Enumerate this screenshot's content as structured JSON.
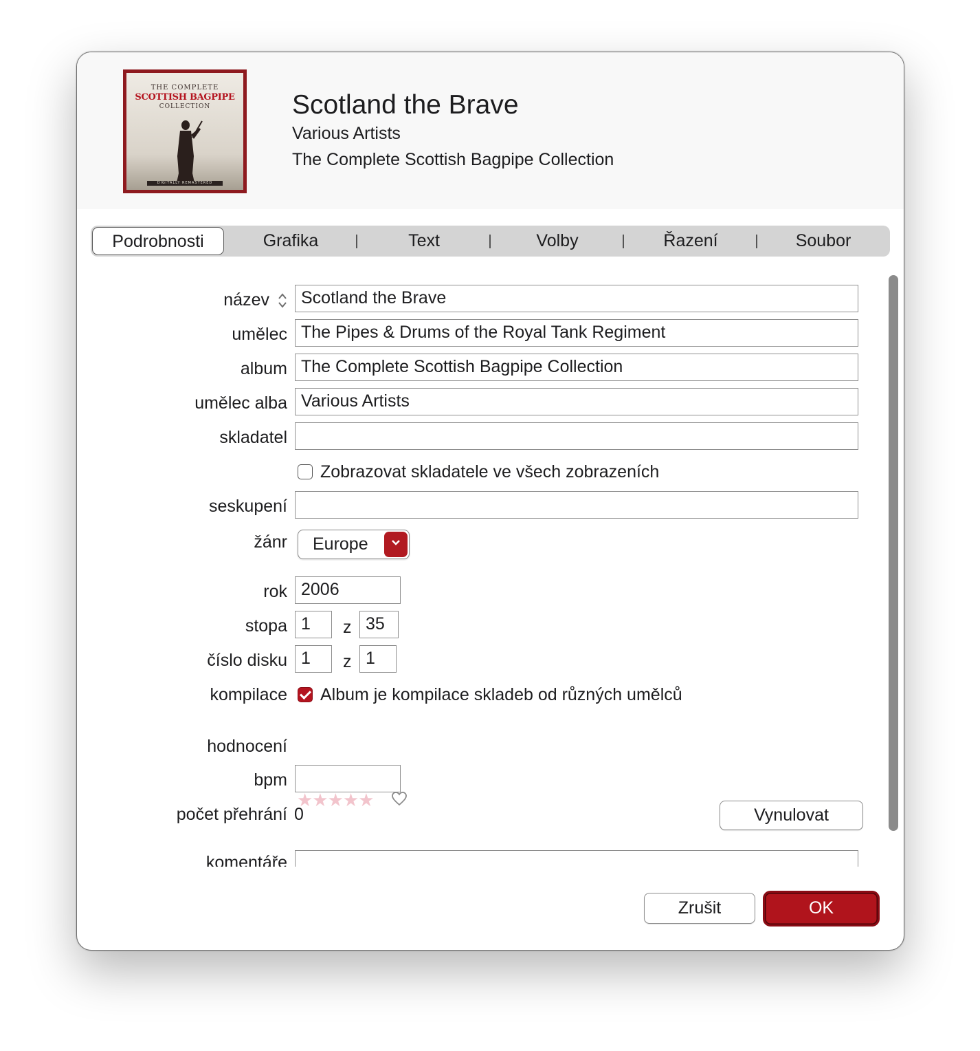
{
  "header": {
    "artwork": {
      "line1": "THE COMPLETE",
      "line2": "SCOTTISH BAGPIPE",
      "line3": "COLLECTION",
      "footer": "DIGITALLY REMASTERED"
    },
    "title": "Scotland the Brave",
    "artist": "Various Artists",
    "album": "The Complete Scottish Bagpipe Collection"
  },
  "tabs": [
    "Podrobnosti",
    "Grafika",
    "Text",
    "Volby",
    "Řazení",
    "Soubor"
  ],
  "active_tab": "Podrobnosti",
  "form": {
    "name_label": "název",
    "name_value": "Scotland the Brave",
    "artist_label": "umělec",
    "artist_value": "The Pipes & Drums of the Royal Tank Regiment",
    "album_label": "album",
    "album_value": "The Complete Scottish Bagpipe Collection",
    "album_artist_label": "umělec alba",
    "album_artist_value": "Various Artists",
    "composer_label": "skladatel",
    "composer_value": "",
    "show_composer_label": "Zobrazovat skladatele ve všech zobrazeních",
    "show_composer_checked": false,
    "grouping_label": "seskupení",
    "grouping_value": "",
    "genre_label": "žánr",
    "genre_value": "Europe",
    "year_label": "rok",
    "year_value": "2006",
    "track_label": "stopa",
    "track_value": "1",
    "track_of_label": "z",
    "track_total": "35",
    "disc_label": "číslo disku",
    "disc_value": "1",
    "disc_of_label": "z",
    "disc_total": "1",
    "compilation_label": "kompilace",
    "compilation_text": "Album je kompilace skladeb od různých umělců",
    "compilation_checked": true,
    "rating_label": "hodnocení",
    "rating_stars": "★★★★★",
    "rating_value": 0,
    "bpm_label": "bpm",
    "bpm_value": "",
    "play_count_label": "počet přehrání",
    "play_count_value": "0",
    "reset_label": "Vynulovat",
    "comments_label": "komentáře"
  },
  "footer": {
    "cancel_label": "Zrušit",
    "ok_label": "OK"
  },
  "colors": {
    "accent": "#b0141c",
    "tab_bar": "#d4d4d4",
    "rating_star": "#f2c4cc"
  }
}
